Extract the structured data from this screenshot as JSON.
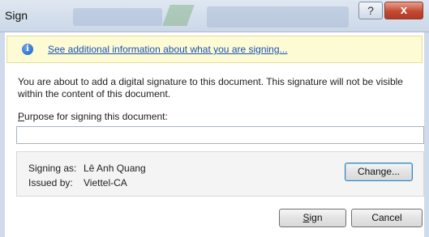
{
  "window": {
    "title": "Sign",
    "help_glyph": "?",
    "close_glyph": "x"
  },
  "infobar": {
    "icon": "info-icon",
    "icon_glyph": "i",
    "link_text": "See additional information about what you are signing..."
  },
  "description": "You are about to add a digital signature to this document. This signature will not be visible within the content of this document.",
  "purpose": {
    "label_prefix": "P",
    "label_rest": "urpose for signing this document:",
    "value": "",
    "placeholder": ""
  },
  "signer": {
    "signing_as_label": "Signing as:",
    "signing_as_value": "Lê Anh Quang",
    "issued_by_label": "Issued by:",
    "issued_by_value": "Viettel-CA",
    "change_button": "Change..."
  },
  "buttons": {
    "sign_prefix": "S",
    "sign_rest": "ign",
    "cancel": "Cancel"
  },
  "colors": {
    "infobar_bg": "#fdfbd4",
    "link": "#1a52b5",
    "close_button": "#c24a33"
  }
}
